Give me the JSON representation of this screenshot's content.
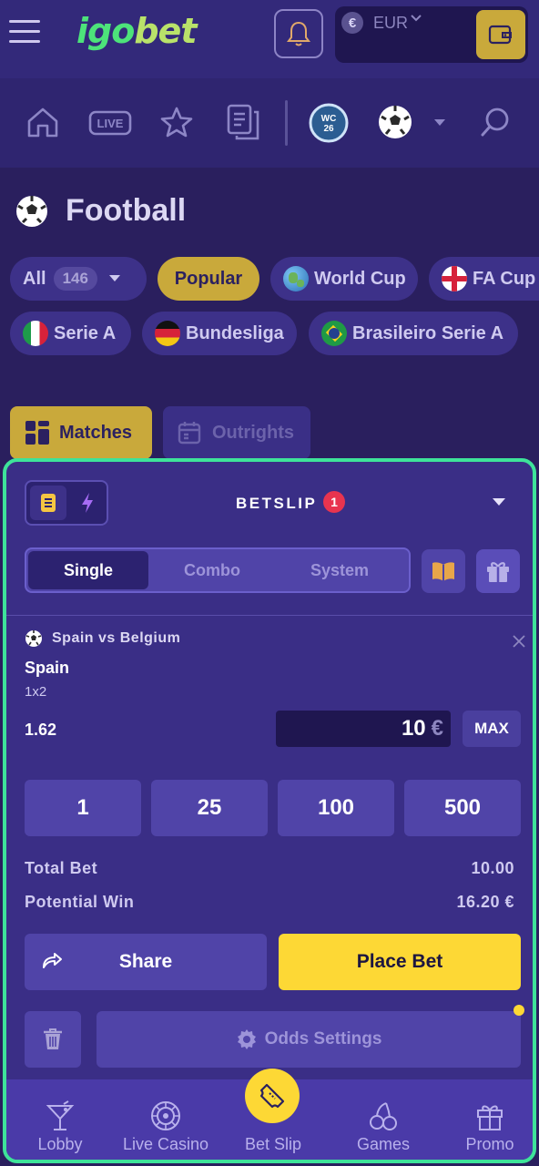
{
  "header": {
    "logo_part1": "igo",
    "logo_part2": "bet",
    "currency_symbol": "€",
    "currency": "EUR"
  },
  "nav_icons": [
    "home-icon",
    "live-icon",
    "favorites-icon",
    "betslip-history-icon",
    "wc26-icon",
    "football-icon",
    "chevron-down-icon",
    "search-icon"
  ],
  "nav_live_label": "LIVE",
  "nav_wc_label": "WC 26",
  "section": {
    "title": "Football"
  },
  "chips_row1": [
    {
      "label": "All",
      "count": "146"
    },
    {
      "label": "Popular"
    },
    {
      "label": "World Cup"
    },
    {
      "label": "FA Cup"
    }
  ],
  "chips_row2": [
    {
      "label": "Serie A"
    },
    {
      "label": "Bundesliga"
    },
    {
      "label": "Brasileiro Serie A"
    }
  ],
  "tabs": {
    "matches": "Matches",
    "outrights": "Outrights"
  },
  "betslip": {
    "title": "BETSLIP",
    "count": "1",
    "bet_types": [
      "Single",
      "Combo",
      "System"
    ],
    "event": "Spain vs Belgium",
    "selection": "Spain",
    "market": "1x2",
    "odds": "1.62",
    "stake": "10",
    "stake_currency": "€",
    "max_label": "MAX",
    "quick_stakes": [
      "1",
      "25",
      "100",
      "500"
    ],
    "total_bet_label": "Total Bet",
    "total_bet_value": "10.00",
    "potential_win_label": "Potential Win",
    "potential_win_value": "16.20 €",
    "share_label": "Share",
    "place_bet_label": "Place Bet",
    "odds_settings_label": "Odds Settings"
  },
  "bottom_nav": [
    {
      "label": "Lobby",
      "icon": "cocktail-icon"
    },
    {
      "label": "Live Casino",
      "icon": "roulette-icon"
    },
    {
      "label": "Bet Slip",
      "icon": "ticket-icon"
    },
    {
      "label": "Games",
      "icon": "cherries-icon"
    },
    {
      "label": "Promo",
      "icon": "gift-icon"
    }
  ],
  "colors": {
    "background": "#2a1f5e",
    "accent_gold": "#c9a93b",
    "accent_yellow": "#fdd835",
    "betslip_border": "#3ee39a",
    "badge_red": "#e8344f"
  }
}
